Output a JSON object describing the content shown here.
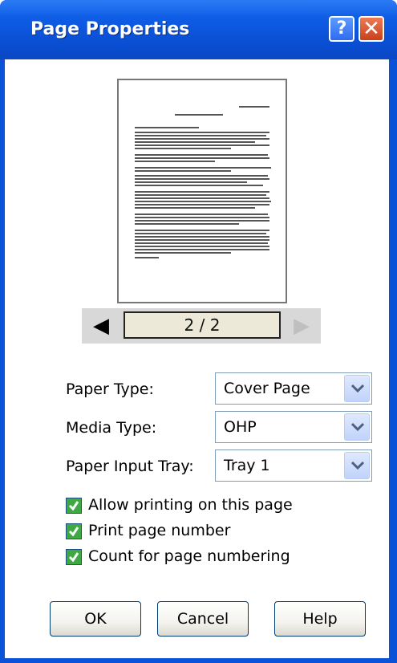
{
  "window": {
    "title": "Page Properties",
    "help_glyph": "?",
    "close_glyph": "✕"
  },
  "preview": {
    "page_indicator": "2 / 2",
    "prev_glyph": "◀",
    "next_glyph": "▶"
  },
  "fields": {
    "paper_type": {
      "label": "Paper Type:",
      "value": "Cover Page"
    },
    "media_type": {
      "label": "Media Type:",
      "value": "OHP"
    },
    "paper_input_tray": {
      "label": "Paper Input Tray:",
      "value": "Tray 1"
    }
  },
  "options": [
    {
      "label": "Allow printing on this page",
      "checked": true
    },
    {
      "label": "Print page number",
      "checked": true
    },
    {
      "label": "Count for page numbering",
      "checked": true
    }
  ],
  "buttons": {
    "ok": "OK",
    "cancel": "Cancel",
    "help": "Help"
  },
  "colors": {
    "title_bar": "#0a4fd4",
    "close_button": "#c8411b",
    "checkbox": "#3ea843"
  }
}
